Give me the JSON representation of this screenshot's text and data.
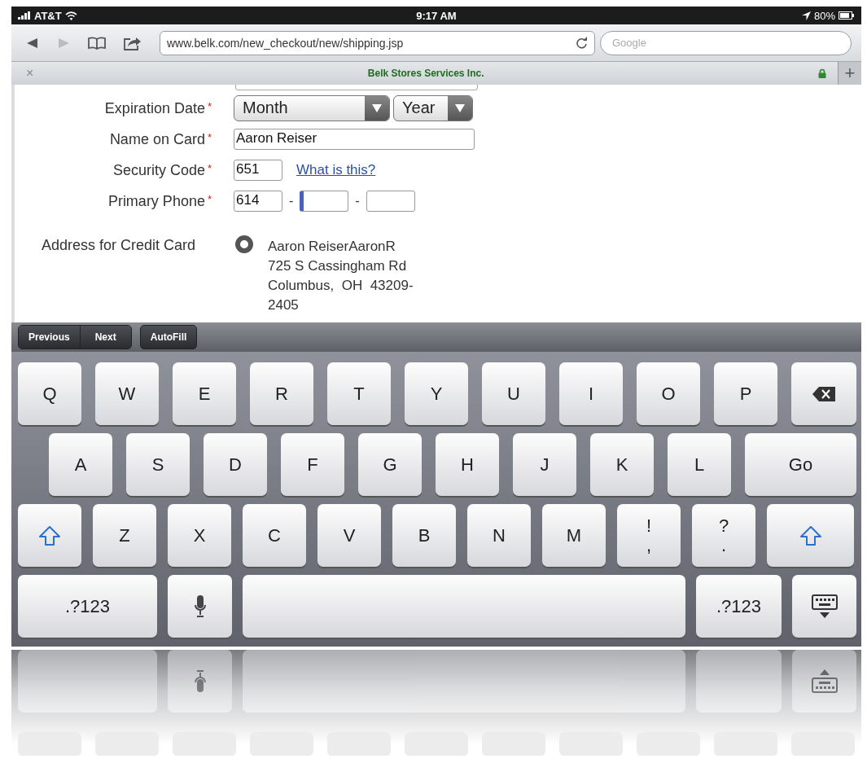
{
  "status_bar": {
    "carrier": "AT&T",
    "time": "9:17 AM",
    "battery": "80%"
  },
  "browser": {
    "back_disabled": false,
    "forward_disabled": true,
    "url": "www.belk.com/new_checkout/new/shipping.jsp",
    "search": {
      "placeholder": "Google"
    },
    "tab": {
      "close": "×",
      "title": "Belk Stores Services Inc.",
      "secure": true,
      "new_tab": "+"
    }
  },
  "form": {
    "fields": [
      {
        "label": "Expiration Date",
        "mark": "*",
        "kind": "selects",
        "selects": [
          {
            "value": "Month"
          },
          {
            "value": "Year"
          }
        ]
      },
      {
        "label": "Name on Card",
        "mark": "*",
        "kind": "text",
        "value": "Aaron Reiser"
      },
      {
        "label": "Security Code",
        "mark": "*",
        "kind": "code",
        "value": "651",
        "link": "What is this?"
      },
      {
        "label": "Primary Phone",
        "mark": "*",
        "kind": "phone",
        "parts": [
          {
            "value": "614",
            "focused": false
          },
          {
            "focused": true
          },
          {
            "focused": false
          }
        ],
        "separators": [
          "-",
          "-"
        ]
      }
    ],
    "address": {
      "label": "Address for Credit Card",
      "options": [
        {
          "selected": true,
          "lines": [
            "Aaron ReiserAaronR",
            "725 S Cassingham Rd",
            "Columbus,  OH  43209-",
            "2405"
          ]
        }
      ]
    }
  },
  "accessory_bar": {
    "nav": [
      "Previous",
      "Next"
    ],
    "autofill": "AutoFill"
  },
  "keyboard": {
    "rows": [
      {
        "keys": [
          {
            "kind": "letter",
            "label": "Q"
          },
          {
            "kind": "letter",
            "label": "W"
          },
          {
            "kind": "letter",
            "label": "E"
          },
          {
            "kind": "letter",
            "label": "R"
          },
          {
            "kind": "letter",
            "label": "T"
          },
          {
            "kind": "letter",
            "label": "Y"
          },
          {
            "kind": "letter",
            "label": "U"
          },
          {
            "kind": "letter",
            "label": "I"
          },
          {
            "kind": "letter",
            "label": "O"
          },
          {
            "kind": "letter",
            "label": "P"
          },
          {
            "kind": "backspace"
          }
        ]
      },
      {
        "keys": [
          {
            "kind": "letter",
            "label": "A"
          },
          {
            "kind": "letter",
            "label": "S"
          },
          {
            "kind": "letter",
            "label": "D"
          },
          {
            "kind": "letter",
            "label": "F"
          },
          {
            "kind": "letter",
            "label": "G"
          },
          {
            "kind": "letter",
            "label": "H"
          },
          {
            "kind": "letter",
            "label": "J"
          },
          {
            "kind": "letter",
            "label": "K"
          },
          {
            "kind": "letter",
            "label": "L"
          },
          {
            "kind": "go",
            "label": "Go"
          }
        ]
      },
      {
        "keys": [
          {
            "kind": "shift"
          },
          {
            "kind": "letter",
            "label": "Z"
          },
          {
            "kind": "letter",
            "label": "X"
          },
          {
            "kind": "letter",
            "label": "C"
          },
          {
            "kind": "letter",
            "label": "V"
          },
          {
            "kind": "letter",
            "label": "B"
          },
          {
            "kind": "letter",
            "label": "N"
          },
          {
            "kind": "letter",
            "label": "M"
          },
          {
            "kind": "punct",
            "top": "!",
            "bottom": ","
          },
          {
            "kind": "punct",
            "top": "?",
            "bottom": "."
          },
          {
            "kind": "shift"
          }
        ]
      },
      {
        "keys": [
          {
            "kind": "numbers",
            "label": ".?123"
          },
          {
            "kind": "mic"
          },
          {
            "kind": "space"
          },
          {
            "kind": "numbers",
            "label": ".?123"
          },
          {
            "kind": "hide"
          }
        ]
      }
    ]
  },
  "reflection": {
    "keys": [
      {
        "kind": "numbers"
      },
      {
        "kind": "mic"
      },
      {
        "kind": "space"
      },
      {
        "kind": "numbers"
      },
      {
        "kind": "hide"
      }
    ]
  }
}
